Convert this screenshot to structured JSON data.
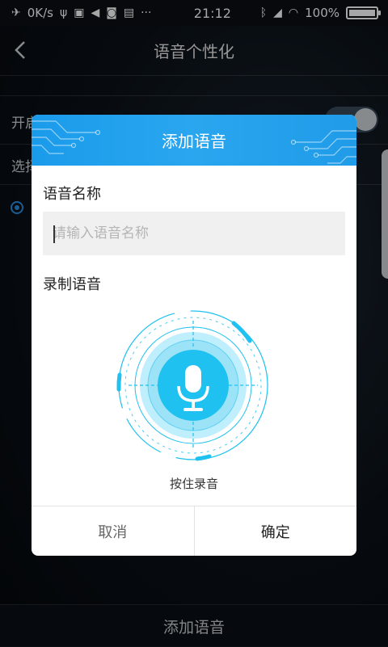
{
  "status_bar": {
    "net_speed": "0K/s",
    "time": "21:12",
    "battery": "100%",
    "battery_level": 1.0,
    "icons": [
      "airplane-icon",
      "usb-icon",
      "signal-icon",
      "volume-icon",
      "app-icon",
      "image-icon",
      "more-icon",
      "bluetooth-icon",
      "mute-icon",
      "wifi-icon",
      "battery-icon"
    ]
  },
  "header": {
    "title": "语音个性化"
  },
  "background_rows": {
    "row1": "开启语音",
    "row2": "选择"
  },
  "bottom_bar": {
    "label": "添加语音"
  },
  "dialog": {
    "title": "添加语音",
    "name_section_label": "语音名称",
    "name_input": {
      "value": "",
      "placeholder": "请输入语音名称"
    },
    "record_section_label": "录制语音",
    "record_hint": "按住录音",
    "cancel_label": "取消",
    "ok_label": "确定"
  },
  "colors": {
    "accent": "#1f9de9",
    "mic": "#1ec1ef"
  }
}
